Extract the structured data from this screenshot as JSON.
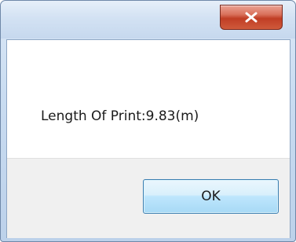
{
  "dialog": {
    "message": "Length Of Print:9.83(m)",
    "ok_label": "OK"
  },
  "titlebar": {
    "close_icon": "close-icon"
  },
  "colors": {
    "close_button": "#c8462c",
    "ok_button_border": "#3c7fb1",
    "footer_bg": "#f0f0f0",
    "frame": "#c9dcf1"
  }
}
